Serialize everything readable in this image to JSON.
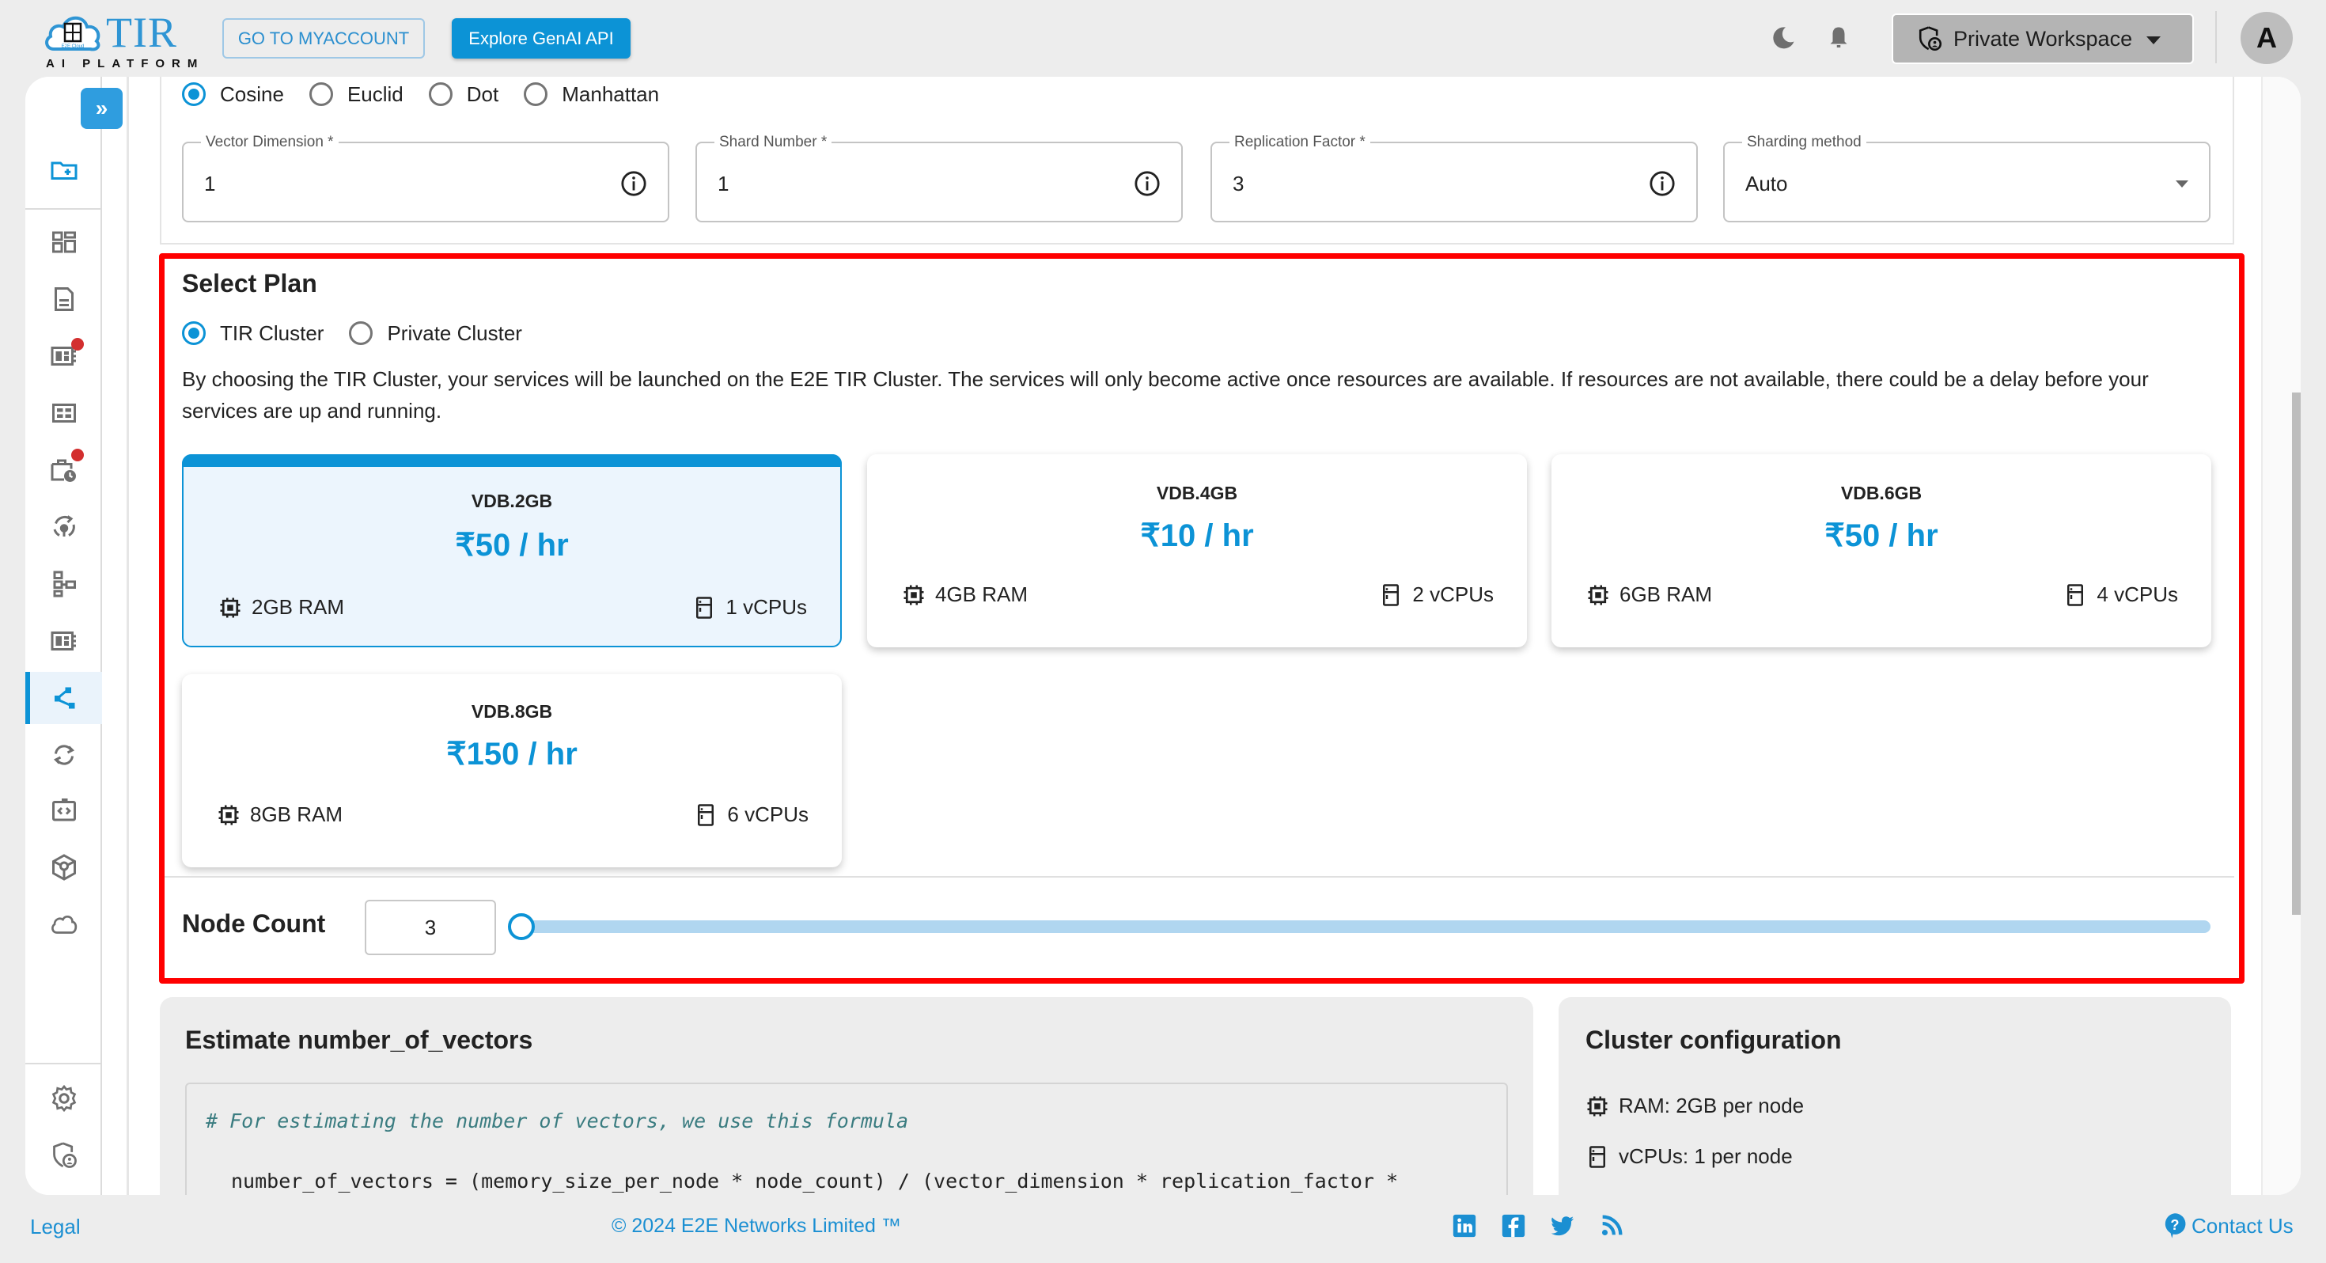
{
  "header": {
    "logo_text": "TIR",
    "logo_subtext": "AI PLATFORM",
    "logo_cloud_text": "E2E Cloud",
    "myaccount_button": "GO TO MYACCOUNT",
    "genai_button": "Explore GenAI API",
    "workspace_label": "Private Workspace",
    "avatar_initial": "A"
  },
  "sidebar": {
    "collapse_label": "»",
    "items": [
      {
        "icon": "folder-plus-icon",
        "active": false
      },
      {
        "icon": "dashboard-icon",
        "active": false
      },
      {
        "icon": "document-icon",
        "active": false
      },
      {
        "icon": "notebook-icon",
        "active": false,
        "badge": true
      },
      {
        "icon": "grid-icon",
        "active": false
      },
      {
        "icon": "scheduled-job-icon",
        "active": false,
        "badge": true
      },
      {
        "icon": "inference-icon",
        "active": false
      },
      {
        "icon": "pipeline-icon",
        "active": false
      },
      {
        "icon": "notebook-2-icon",
        "active": false
      },
      {
        "icon": "vector-db-icon",
        "active": true
      },
      {
        "icon": "sync-icon",
        "active": false
      },
      {
        "icon": "code-icon",
        "active": false
      },
      {
        "icon": "model-box-icon",
        "active": false
      },
      {
        "icon": "cloud-icon",
        "active": false
      },
      {
        "icon": "settings-icon",
        "active": false
      },
      {
        "icon": "security-icon",
        "active": false
      }
    ]
  },
  "similarity": {
    "options": [
      "Cosine",
      "Euclid",
      "Dot",
      "Manhattan"
    ],
    "selected": "Cosine"
  },
  "fields": {
    "vector_dimension": {
      "label": "Vector Dimension *",
      "value": "1"
    },
    "shard_number": {
      "label": "Shard Number *",
      "value": "1"
    },
    "replication_factor": {
      "label": "Replication Factor *",
      "value": "3"
    },
    "sharding_method": {
      "label": "Sharding method",
      "value": "Auto"
    }
  },
  "plan": {
    "title": "Select Plan",
    "cluster_options": [
      "TIR Cluster",
      "Private Cluster"
    ],
    "selected_cluster": "TIR Cluster",
    "description": "By choosing the TIR Cluster, your services will be launched on the E2E TIR Cluster. The services will only become active once resources are available. If resources are not available, there could be a delay before your services are up and running.",
    "cards": [
      {
        "name": "VDB.2GB",
        "price": "₹50 / hr",
        "ram": "2GB RAM",
        "cpu": "1 vCPUs",
        "selected": true
      },
      {
        "name": "VDB.4GB",
        "price": "₹10 / hr",
        "ram": "4GB RAM",
        "cpu": "2 vCPUs",
        "selected": false
      },
      {
        "name": "VDB.6GB",
        "price": "₹50 / hr",
        "ram": "6GB RAM",
        "cpu": "4 vCPUs",
        "selected": false
      },
      {
        "name": "VDB.8GB",
        "price": "₹150 / hr",
        "ram": "8GB RAM",
        "cpu": "6 vCPUs",
        "selected": false
      }
    ],
    "node_count_label": "Node Count",
    "node_count_value": "3",
    "node_count_slider_fraction": 0
  },
  "estimate": {
    "title": "Estimate number_of_vectors",
    "comment": "# For estimating the number of vectors, we use this formula",
    "formula": "number_of_vectors = (memory_size_per_node * node_count) / (vector_dimension * replication_factor *"
  },
  "cluster_config": {
    "title": "Cluster configuration",
    "ram": "RAM: 2GB per node",
    "vcpus": "vCPUs: 1 per node"
  },
  "footer": {
    "legal": "Legal",
    "copyright": "© 2024 E2E Networks Limited ™",
    "contact": "Contact Us"
  },
  "colors": {
    "accent": "#0c93d6",
    "highlight": "#ff0000",
    "badge": "#d32f2f"
  }
}
